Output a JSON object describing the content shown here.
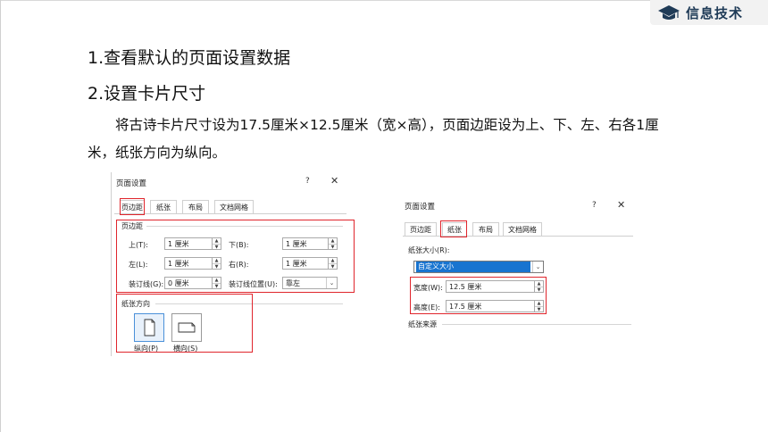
{
  "brand": {
    "icon": "graduation-cap-icon",
    "text": "信息技术",
    "color": "#1f3b57"
  },
  "heading1": "1.查看默认的页面设置数据",
  "heading2": "2.设置卡片尺寸",
  "paragraph": "将古诗卡片尺寸设为17.5厘米×12.5厘米（宽×高），页面边距设为上、下、左、右各1厘米，纸张方向为纵向。",
  "dialog_left": {
    "title": "页面设置",
    "help": "?",
    "close": "✕",
    "tabs": [
      "页边距",
      "纸张",
      "布局",
      "文档网格"
    ],
    "section_margins": "页边距",
    "fields": {
      "top_label": "上(T):",
      "top_value": "1 厘米",
      "bottom_label": "下(B):",
      "bottom_value": "1 厘米",
      "left_label": "左(L):",
      "left_value": "1 厘米",
      "right_label": "右(R):",
      "right_value": "1 厘米",
      "gutter_label": "装订线(G):",
      "gutter_value": "0 厘米",
      "gutter_pos_label": "装订线位置(U):",
      "gutter_pos_value": "靠左"
    },
    "section_orientation": "纸张方向",
    "portrait": "纵向(P)",
    "landscape": "横向(S)"
  },
  "dialog_right": {
    "title": "页面设置",
    "help": "?",
    "close": "✕",
    "tabs": [
      "页边距",
      "纸张",
      "布局",
      "文档网格"
    ],
    "section_size": "纸张大小(R):",
    "size_value": "自定义大小",
    "width_label": "宽度(W):",
    "width_value": "12.5 厘米",
    "height_label": "高度(E):",
    "height_value": "17.5 厘米",
    "section_source": "纸张来源"
  },
  "colors": {
    "highlight": "#e0252c",
    "selected": "#1874d0"
  }
}
